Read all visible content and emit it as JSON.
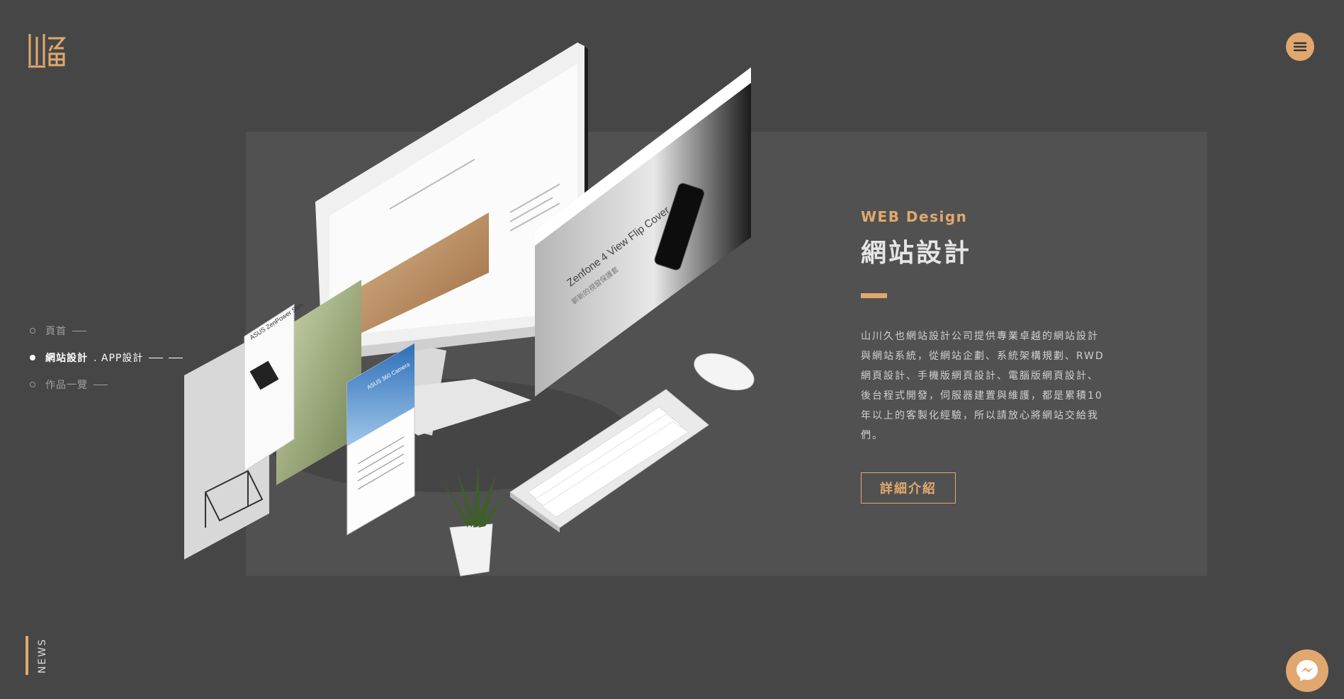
{
  "colors": {
    "background": "#464646",
    "panel": "#515151",
    "accent": "#e0a86f",
    "text": "#d8d8d8"
  },
  "logo": {
    "icon": "logo-mark"
  },
  "header": {
    "menu_icon": "hamburger-icon"
  },
  "side_nav": {
    "items": [
      {
        "label": "頁首",
        "sub": "",
        "active": false
      },
      {
        "label": "網站設計",
        "sub": ". APP設計",
        "active": true
      },
      {
        "label": "作品一覽",
        "sub": "",
        "active": false
      }
    ]
  },
  "hero": {
    "monitor_text": "Zenfone 4 View Flip Cover",
    "monitor_subtext": "嶄新的視窗保護套",
    "tablet_text": "ASUS ZenPower Slim",
    "phone_text": "ASUS 360 Camera"
  },
  "content": {
    "eyebrow": "WEB Design",
    "title": "網站設計",
    "description": "山川久也網站設計公司提供專業卓越的網站設計與網站系統，從網站企劃、系統架構規劃、RWD網頁設計、手機版網頁設計、電腦版網頁設計、後台程式開發，伺服器建置與維護，都是累積10年以上的客製化經驗，所以請放心將網站交給我們。",
    "cta_label": "詳細介紹"
  },
  "news": {
    "label": "NEWS"
  },
  "chat": {
    "icon": "messenger-icon"
  }
}
